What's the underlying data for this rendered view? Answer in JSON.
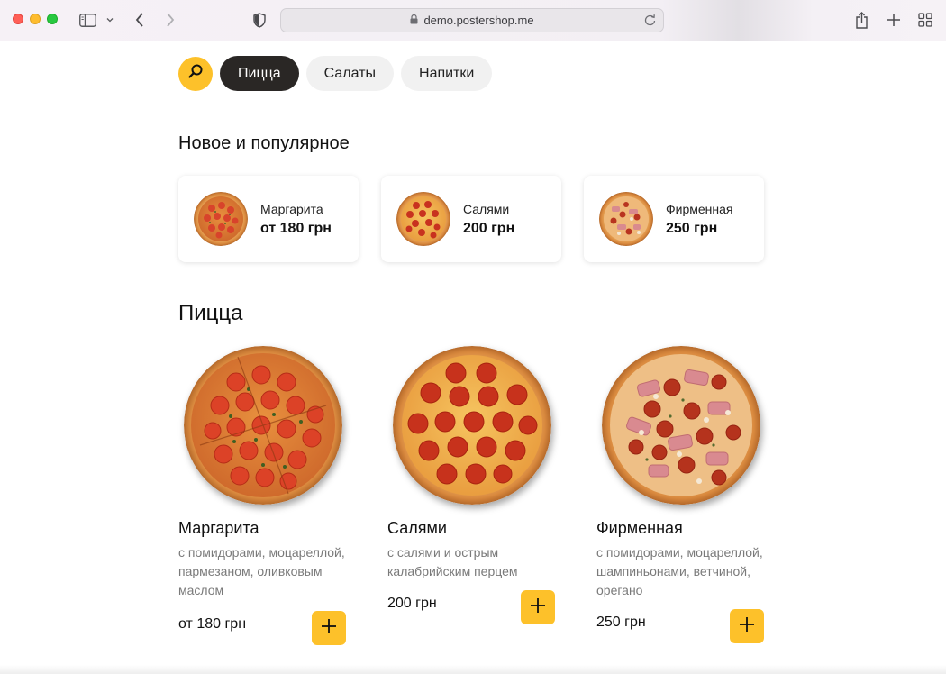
{
  "browser": {
    "url": "demo.postershop.me",
    "icons": [
      "sidebar-icon",
      "chevron-down-icon",
      "back-icon",
      "forward-icon",
      "shield-icon",
      "lock-icon",
      "reload-icon",
      "share-icon",
      "plus-icon",
      "tabs-grid-icon"
    ]
  },
  "categories": {
    "search_icon": "search-icon",
    "items": [
      {
        "label": "Пицца",
        "active": true
      },
      {
        "label": "Салаты",
        "active": false
      },
      {
        "label": "Напитки",
        "active": false
      }
    ]
  },
  "popular": {
    "title": "Новое и популярное",
    "items": [
      {
        "name": "Маргарита",
        "price": "от 180 грн"
      },
      {
        "name": "Салями",
        "price": "200 грн"
      },
      {
        "name": "Фирменная",
        "price": "250 грн"
      }
    ]
  },
  "pizza_section": {
    "title": "Пицца",
    "products": [
      {
        "name": "Маргарита",
        "desc": "с помидорами, моцареллой, пармезаном, оливковым маслом",
        "price": "от 180 грн"
      },
      {
        "name": "Салями",
        "desc": "с салями и острым калабрийским перцем",
        "price": "200 грн"
      },
      {
        "name": "Фирменная",
        "desc": "с помидорами, моцареллой, шампиньонами, ветчиной, орегано",
        "price": "250 грн"
      }
    ],
    "add_icon": "plus-icon"
  },
  "colors": {
    "accent": "#fdc12a",
    "active_pill": "#2a2725"
  }
}
